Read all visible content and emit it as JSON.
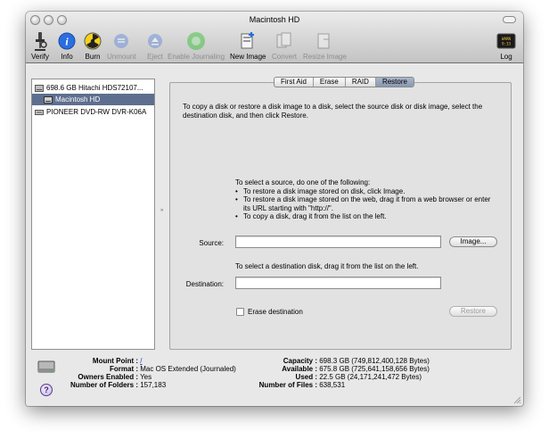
{
  "window": {
    "title": "Macintosh HD"
  },
  "toolbar": {
    "verify": "Verify",
    "info": "Info",
    "burn": "Burn",
    "unmount": "Unmount",
    "eject": "Eject",
    "enable_journaling": "Enable Journaling",
    "new_image": "New Image",
    "convert": "Convert",
    "resize_image": "Resize Image",
    "log": "Log",
    "log_badge": "WARN 9:33"
  },
  "sidebar": {
    "items": [
      {
        "label": "698.6 GB Hitachi HDS72107..."
      },
      {
        "label": "Macintosh HD"
      },
      {
        "label": "PIONEER DVD-RW DVR-K06A"
      }
    ]
  },
  "tabs": [
    "First Aid",
    "Erase",
    "RAID",
    "Restore"
  ],
  "restore": {
    "intro": "To copy a disk or restore a disk image to a disk, select the source disk or disk image, select the destination disk, and then click Restore.",
    "source_heading": "To select a source, do one of the following:",
    "source_bullets": [
      "To restore a disk image stored on disk, click Image.",
      "To restore a disk image stored on the web, drag it from a web browser or enter its URL starting with \"http://\".",
      "To copy a disk, drag it from the list on the left."
    ],
    "source_label": "Source:",
    "source_value": "",
    "image_button": "Image...",
    "destination_heading": "To select a destination disk, drag it from the list on the left.",
    "destination_label": "Destination:",
    "destination_value": "",
    "erase_destination": "Erase destination",
    "erase_checked": false,
    "restore_button": "Restore"
  },
  "info": {
    "mount_point_key": "Mount Point :",
    "mount_point_val": "/",
    "format_key": "Format :",
    "format_val": "Mac OS Extended (Journaled)",
    "owners_key": "Owners Enabled :",
    "owners_val": "Yes",
    "folders_key": "Number of Folders :",
    "folders_val": "157,183",
    "capacity_key": "Capacity :",
    "capacity_val": "698.3 GB (749,812,400,128 Bytes)",
    "available_key": "Available :",
    "available_val": "675.8 GB (725,641,158,656 Bytes)",
    "used_key": "Used :",
    "used_val": "22.5 GB (24,171,241,472 Bytes)",
    "files_key": "Number of Files :",
    "files_val": "638,531",
    "help": "?"
  }
}
